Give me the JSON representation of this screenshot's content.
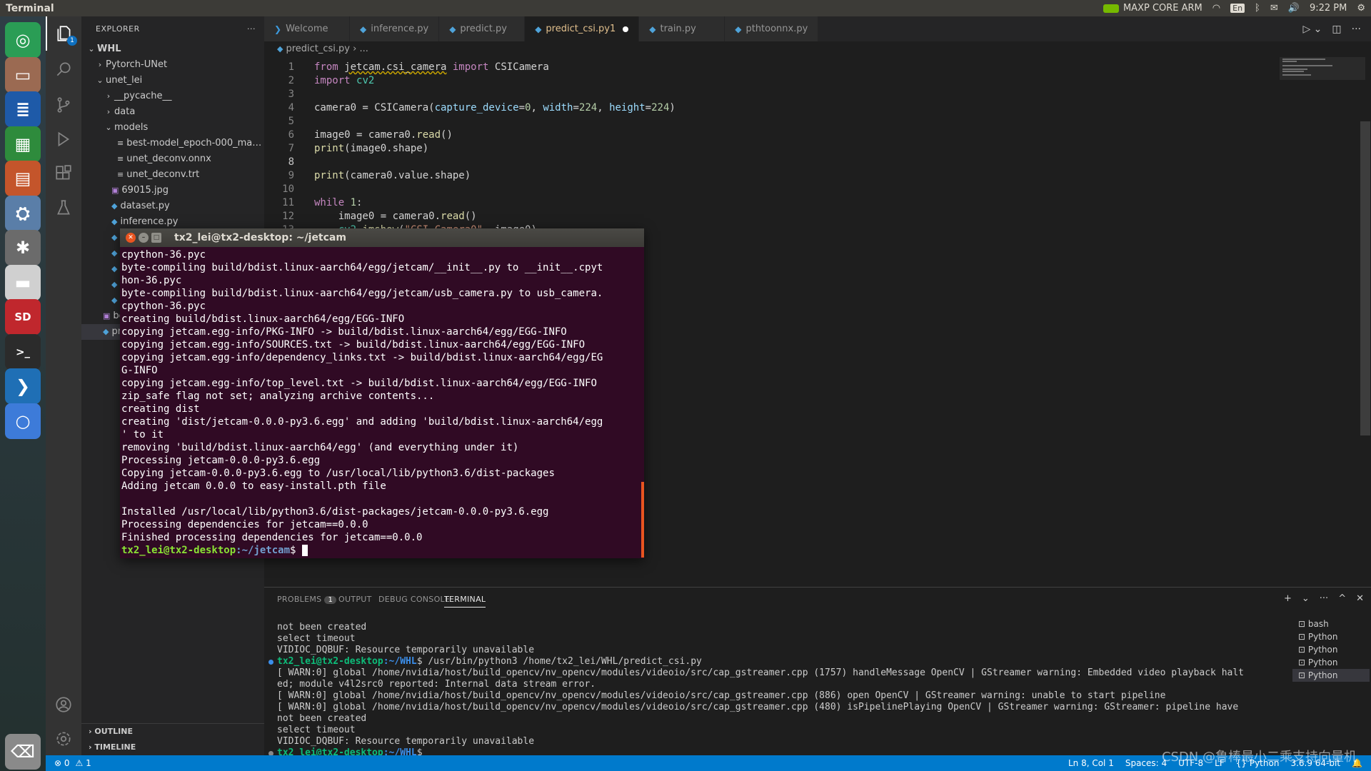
{
  "topbar": {
    "app": "Terminal",
    "nvidia": "MAXP CORE ARM",
    "lang": "En",
    "time": "9:22 PM"
  },
  "launcher": [
    {
      "name": "ubuntu-dash-icon",
      "bg": "#2a9d55",
      "glyph": "◎"
    },
    {
      "name": "files-icon",
      "bg": "#9b6a52",
      "glyph": "▭"
    },
    {
      "name": "writer-icon",
      "bg": "#1e5aa8",
      "glyph": "≣"
    },
    {
      "name": "calc-icon",
      "bg": "#2e8b3c",
      "glyph": "▦"
    },
    {
      "name": "impress-icon",
      "bg": "#c4552b",
      "glyph": "▤"
    },
    {
      "name": "software-center-icon",
      "bg": "#5a7ea8",
      "glyph": "⛭"
    },
    {
      "name": "system-settings-icon",
      "bg": "#6b6b6b",
      "glyph": "✱"
    },
    {
      "name": "drive-icon",
      "bg": "#d0d0d0",
      "glyph": "▬"
    },
    {
      "name": "sd-card-icon",
      "bg": "#c0272d",
      "glyph": "SD"
    },
    {
      "name": "terminal-icon",
      "bg": "#2b2b2b",
      "glyph": ">_"
    },
    {
      "name": "vscode-icon",
      "bg": "#1f6fb5",
      "glyph": "❯"
    },
    {
      "name": "chromium-icon",
      "bg": "#3d7bd9",
      "glyph": "○"
    },
    {
      "name": "trash-icon",
      "bg": "#8a8a8a",
      "glyph": "⌫"
    }
  ],
  "activity": {
    "explorer_badge": "1"
  },
  "sidebar": {
    "title": "EXPLORER",
    "more": "···",
    "tree": [
      {
        "label": "WHL",
        "type": "root",
        "chev": "⌄",
        "indent": 6
      },
      {
        "label": "Pytorch-UNet",
        "type": "folder",
        "chev": "›",
        "indent": 18
      },
      {
        "label": "unet_lei",
        "type": "folder",
        "chev": "⌄",
        "indent": 18
      },
      {
        "label": "__pycache__",
        "type": "folder",
        "chev": "›",
        "indent": 30
      },
      {
        "label": "data",
        "type": "folder",
        "chev": "›",
        "indent": 30
      },
      {
        "label": "models",
        "type": "folder",
        "chev": "⌄",
        "indent": 30
      },
      {
        "label": "best-model_epoch-000_mae-1.0...",
        "type": "lines",
        "indent": 50
      },
      {
        "label": "unet_deconv.onnx",
        "type": "lines",
        "indent": 50
      },
      {
        "label": "unet_deconv.trt",
        "type": "lines",
        "indent": 50
      },
      {
        "label": "69015.jpg",
        "type": "img",
        "indent": 42
      },
      {
        "label": "dataset.py",
        "type": "py",
        "indent": 42
      },
      {
        "label": "inference.py",
        "type": "py",
        "indent": 42
      },
      {
        "label": "pr",
        "type": "py",
        "indent": 42
      },
      {
        "label": "pt",
        "type": "py",
        "indent": 42
      },
      {
        "label": "tr",
        "type": "py",
        "indent": 42
      },
      {
        "label": "ur",
        "type": "py",
        "indent": 42
      },
      {
        "label": "ur",
        "type": "py",
        "indent": 42
      },
      {
        "label": "bes",
        "type": "img",
        "indent": 30
      },
      {
        "label": "pre",
        "type": "py",
        "indent": 30,
        "sel": true
      }
    ],
    "outline": "OUTLINE",
    "timeline": "TIMELINE"
  },
  "tabs": [
    {
      "label": "Welcome",
      "icon": "vscode"
    },
    {
      "label": "inference.py",
      "icon": "py"
    },
    {
      "label": "predict.py",
      "icon": "py"
    },
    {
      "label": "predict_csi.py",
      "suffix": " 1",
      "icon": "py",
      "active": true,
      "dirty": true
    },
    {
      "label": "train.py",
      "icon": "py"
    },
    {
      "label": "pthtoonnx.py",
      "icon": "py"
    }
  ],
  "breadcrumb": {
    "file": "predict_csi.py",
    "rest": " › ..."
  },
  "editor": {
    "cursor_line": 8,
    "lines": [
      [
        {
          "c": "kw",
          "t": "from "
        },
        {
          "c": "sq",
          "t": "jetcam.csi_camera"
        },
        {
          "c": "kw",
          "t": " import "
        },
        {
          "t": "CSICamera"
        }
      ],
      [
        {
          "c": "kw",
          "t": "import "
        },
        {
          "c": "mo",
          "t": "cv2"
        }
      ],
      [],
      [
        {
          "t": "camera0 = CSICamera("
        },
        {
          "c": "pa",
          "t": "capture_device"
        },
        {
          "t": "="
        },
        {
          "c": "nm",
          "t": "0"
        },
        {
          "t": ", "
        },
        {
          "c": "pa",
          "t": "width"
        },
        {
          "t": "="
        },
        {
          "c": "nm",
          "t": "224"
        },
        {
          "t": ", "
        },
        {
          "c": "pa",
          "t": "height"
        },
        {
          "t": "="
        },
        {
          "c": "nm",
          "t": "224"
        },
        {
          "t": ")"
        }
      ],
      [],
      [
        {
          "t": "image0 = camera0."
        },
        {
          "c": "fn",
          "t": "read"
        },
        {
          "t": "()"
        }
      ],
      [
        {
          "c": "fn",
          "t": "print"
        },
        {
          "t": "(image0.shape)"
        }
      ],
      [],
      [
        {
          "c": "fn",
          "t": "print"
        },
        {
          "t": "(camera0.value.shape)"
        }
      ],
      [],
      [
        {
          "c": "kw",
          "t": "while "
        },
        {
          "c": "nm",
          "t": "1"
        },
        {
          "t": ":"
        }
      ],
      [
        {
          "t": "    image0 = camera0."
        },
        {
          "c": "fn",
          "t": "read"
        },
        {
          "t": "()"
        }
      ],
      [
        {
          "t": "    "
        },
        {
          "c": "mo",
          "t": "cv2"
        },
        {
          "t": "."
        },
        {
          "c": "fn",
          "t": "imshow"
        },
        {
          "t": "("
        },
        {
          "c": "st",
          "t": "\"CSI Camera0\""
        },
        {
          "t": ", image0)"
        }
      ]
    ]
  },
  "panel": {
    "tabs": [
      "PROBLEMS",
      "OUTPUT",
      "DEBUG CONSOLE",
      "TERMINAL"
    ],
    "problems_count": "1",
    "active_tab": "TERMINAL",
    "actions": [
      "+",
      "⌄",
      "···",
      "^",
      "✕"
    ],
    "lines": [
      {
        "t": "not been created"
      },
      {
        "t": "select timeout"
      },
      {
        "t": "VIDIOC_DQBUF: Resource temporarily unavailable"
      },
      {
        "p": "tx2_lei@tx2-desktop",
        "path": ":~/WHL",
        "t": "$ /usr/bin/python3 /home/tx2_lei/WHL/predict_csi.py",
        "dot": "#3b8eea"
      },
      {
        "t": "[ WARN:0] global /home/nvidia/host/build_opencv/nv_opencv/modules/videoio/src/cap_gstreamer.cpp (1757) handleMessage OpenCV | GStreamer warning: Embedded video playback halt"
      },
      {
        "t": "ed; module v4l2src0 reported: Internal data stream error."
      },
      {
        "t": "[ WARN:0] global /home/nvidia/host/build_opencv/nv_opencv/modules/videoio/src/cap_gstreamer.cpp (886) open OpenCV | GStreamer warning: unable to start pipeline"
      },
      {
        "t": "[ WARN:0] global /home/nvidia/host/build_opencv/nv_opencv/modules/videoio/src/cap_gstreamer.cpp (480) isPipelinePlaying OpenCV | GStreamer warning: GStreamer: pipeline have"
      },
      {
        "t": "not been created"
      },
      {
        "t": "select timeout"
      },
      {
        "t": "VIDIOC_DQBUF: Resource temporarily unavailable"
      },
      {
        "p": "tx2_lei@tx2-desktop",
        "path": ":~/WHL",
        "t": "$",
        "dot": "#888"
      }
    ],
    "terminals": [
      {
        "label": "bash"
      },
      {
        "label": "Python"
      },
      {
        "label": "Python"
      },
      {
        "label": "Python"
      },
      {
        "label": "Python",
        "sel": true
      }
    ]
  },
  "statusbar": {
    "errors": "⊗ 0",
    "warnings": "⚠ 1",
    "position": "Ln 8, Col 1",
    "spaces": "Spaces: 4",
    "encoding": "UTF-8",
    "eol": "LF",
    "lang": "Python",
    "interp": "3.6.9 64-bit"
  },
  "watermark": "CSDN @鲁棒最小二乘支持向量机",
  "termwin": {
    "title": "tx2_lei@tx2-desktop: ~/jetcam",
    "lines": [
      "cpython-36.pyc",
      "byte-compiling build/bdist.linux-aarch64/egg/jetcam/__init__.py to __init__.cpyt",
      "hon-36.pyc",
      "byte-compiling build/bdist.linux-aarch64/egg/jetcam/usb_camera.py to usb_camera.",
      "cpython-36.pyc",
      "creating build/bdist.linux-aarch64/egg/EGG-INFO",
      "copying jetcam.egg-info/PKG-INFO -> build/bdist.linux-aarch64/egg/EGG-INFO",
      "copying jetcam.egg-info/SOURCES.txt -> build/bdist.linux-aarch64/egg/EGG-INFO",
      "copying jetcam.egg-info/dependency_links.txt -> build/bdist.linux-aarch64/egg/EG",
      "G-INFO",
      "copying jetcam.egg-info/top_level.txt -> build/bdist.linux-aarch64/egg/EGG-INFO",
      "zip_safe flag not set; analyzing archive contents...",
      "creating dist",
      "creating 'dist/jetcam-0.0.0-py3.6.egg' and adding 'build/bdist.linux-aarch64/egg",
      "' to it",
      "removing 'build/bdist.linux-aarch64/egg' (and everything under it)",
      "Processing jetcam-0.0.0-py3.6.egg",
      "Copying jetcam-0.0.0-py3.6.egg to /usr/local/lib/python3.6/dist-packages",
      "Adding jetcam 0.0.0 to easy-install.pth file",
      "",
      "Installed /usr/local/lib/python3.6/dist-packages/jetcam-0.0.0-py3.6.egg",
      "Processing dependencies for jetcam==0.0.0",
      "Finished processing dependencies for jetcam==0.0.0"
    ],
    "prompt_user": "tx2_lei@tx2-desktop",
    "prompt_path": ":~/jetcam",
    "prompt_end": "$ "
  }
}
